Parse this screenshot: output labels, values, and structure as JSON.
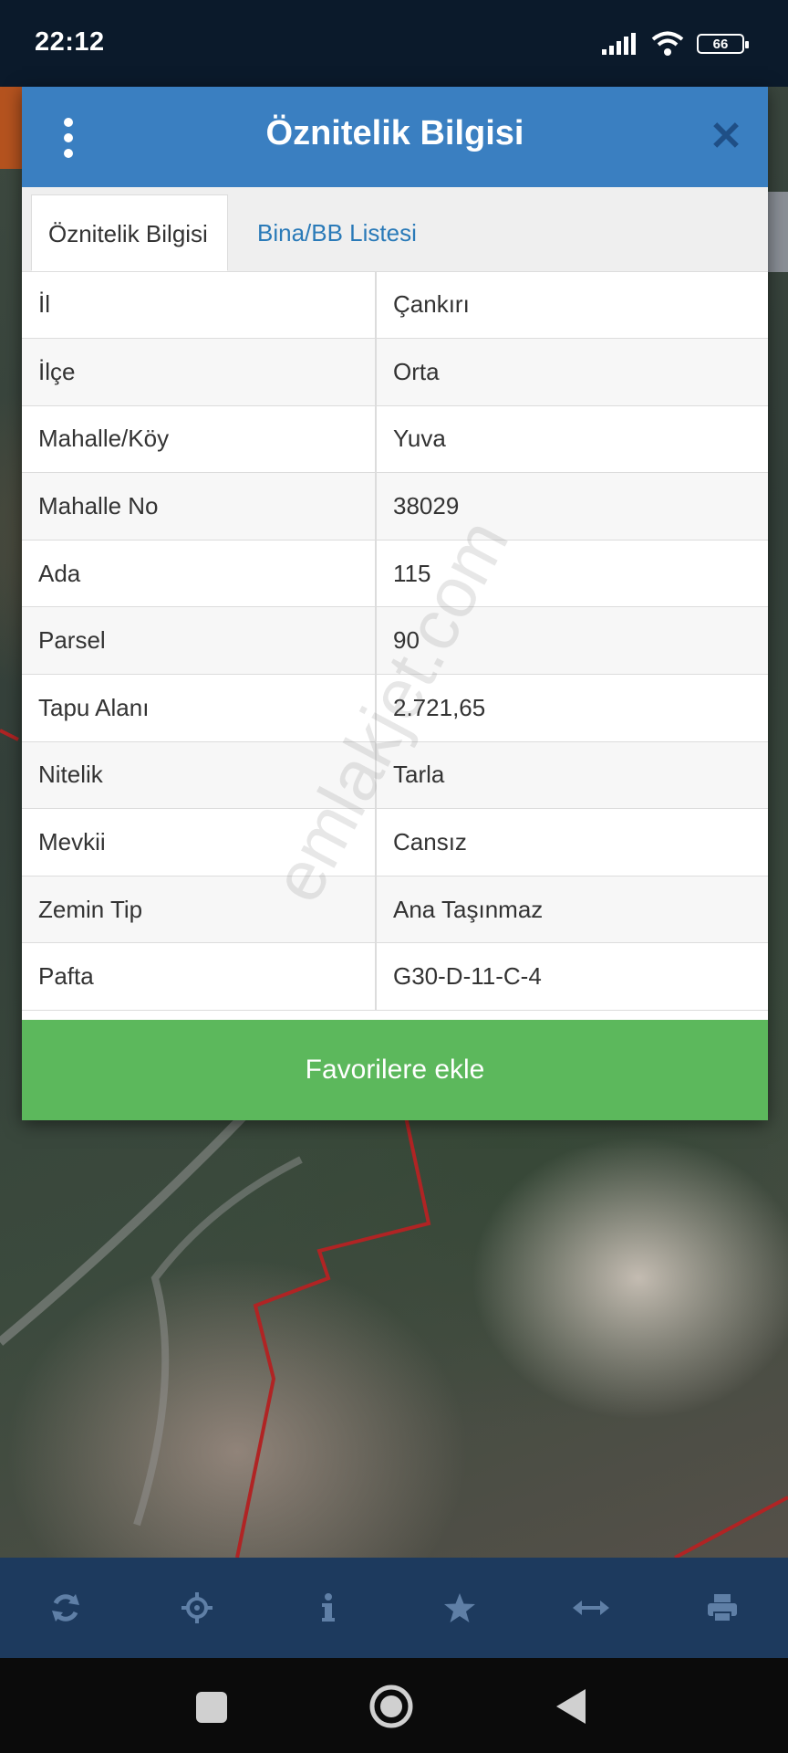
{
  "status": {
    "time": "22:12",
    "battery": "66"
  },
  "dialog": {
    "title": "Öznitelik Bilgisi",
    "tabs": [
      {
        "label": "Öznitelik Bilgisi"
      },
      {
        "label": "Bina/BB Listesi"
      }
    ],
    "rows": [
      {
        "key": "İl",
        "value": "Çankırı"
      },
      {
        "key": "İlçe",
        "value": "Orta"
      },
      {
        "key": "Mahalle/Köy",
        "value": "Yuva"
      },
      {
        "key": "Mahalle No",
        "value": "38029"
      },
      {
        "key": "Ada",
        "value": "115"
      },
      {
        "key": "Parsel",
        "value": "90"
      },
      {
        "key": "Tapu Alanı",
        "value": "2.721,65"
      },
      {
        "key": "Nitelik",
        "value": "Tarla"
      },
      {
        "key": "Mevkii",
        "value": "Cansız"
      },
      {
        "key": "Zemin Tip",
        "value": "Ana Taşınmaz"
      },
      {
        "key": "Pafta",
        "value": "G30-D-11-C-4"
      }
    ],
    "favorite_label": "Favorilere ekle"
  },
  "watermark": "emlakjet.com",
  "toolbar": {
    "icons": [
      "refresh-icon",
      "locate-icon",
      "info-icon",
      "star-icon",
      "measure-icon",
      "print-icon"
    ]
  },
  "colors": {
    "header": "#3a7fc1",
    "favorite": "#5cb85c",
    "toolbar": "#1d3a5e",
    "parcel_line": "#b02424"
  }
}
